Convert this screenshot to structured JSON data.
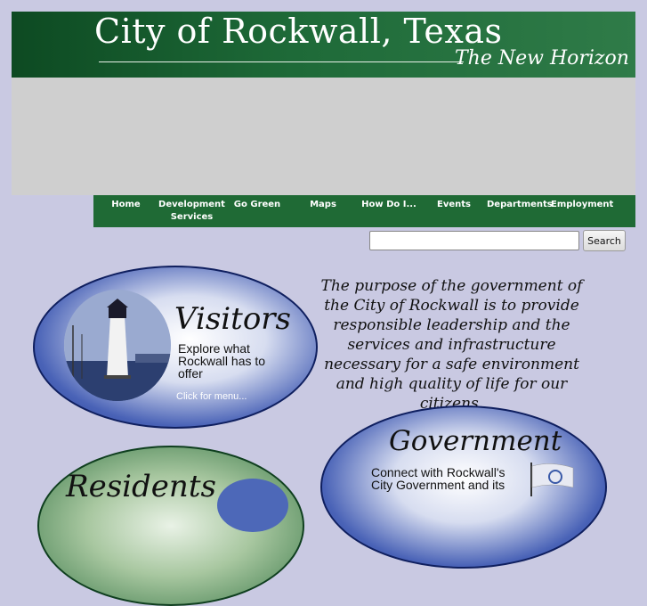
{
  "header": {
    "title": "City of Rockwall, Texas",
    "tagline": "The New Horizon"
  },
  "nav": {
    "items": [
      {
        "label": "Home"
      },
      {
        "label": "Development Services"
      },
      {
        "label": "Go Green"
      },
      {
        "label": "Maps"
      },
      {
        "label": "How Do I..."
      },
      {
        "label": "Events"
      },
      {
        "label": "Departments"
      },
      {
        "label": "Employment"
      }
    ]
  },
  "search": {
    "value": "",
    "button_label": "Search"
  },
  "purpose": {
    "text": "The purpose of the government of the City of Rockwall is to provide responsible leadership and the services and infrastructure necessary for a safe environment and high quality of life for our citizens."
  },
  "sections": {
    "visitors": {
      "title": "Visitors",
      "description": "Explore what Rockwall has to offer",
      "link": "Click for menu..."
    },
    "government": {
      "title": "Government",
      "description": "Connect with Rockwall's City Government and its"
    },
    "residents": {
      "title": "Residents"
    }
  },
  "colors": {
    "header_green": "#1e6a38",
    "nav_green": "#1f6a35",
    "page_background": "#c9c9e2",
    "oval_blue": "#1d3590"
  }
}
